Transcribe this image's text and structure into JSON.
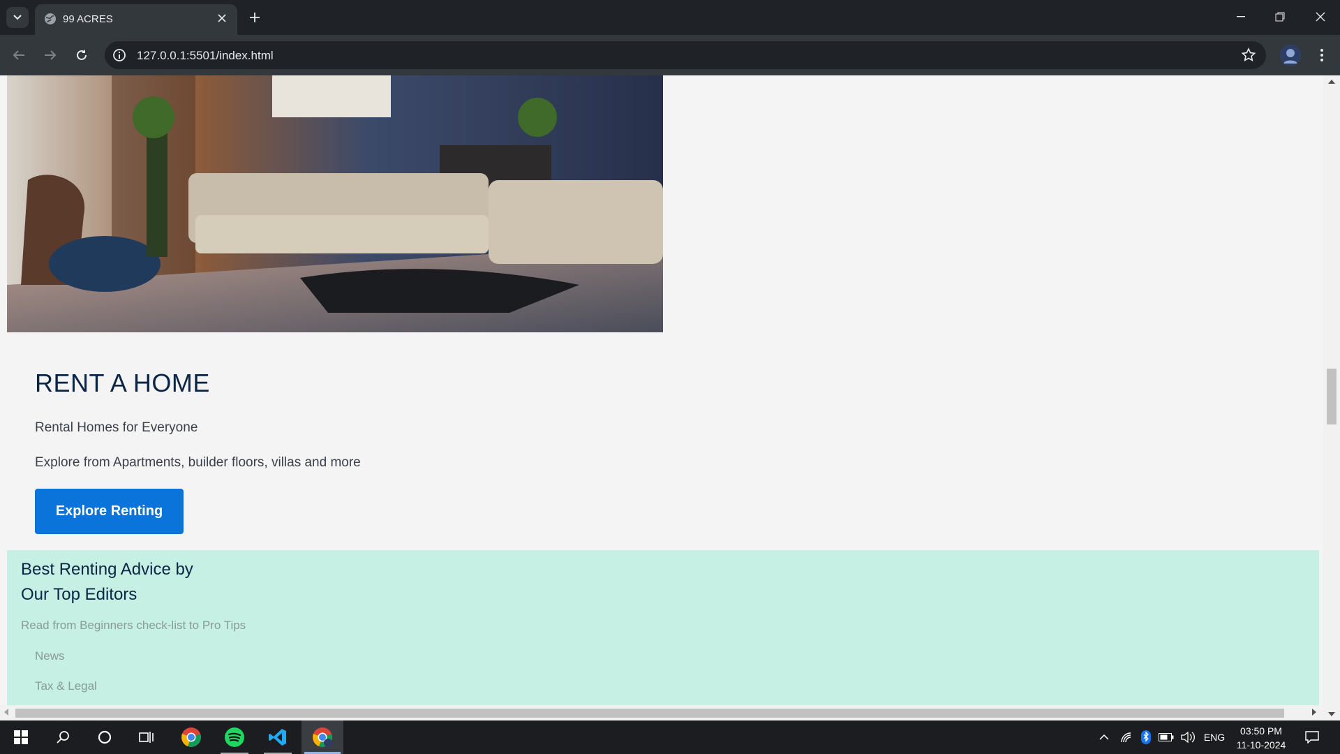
{
  "browser": {
    "tab_title": "99 ACRES",
    "url": "127.0.0.1:5501/index.html"
  },
  "rent": {
    "title": "RENT A HOME",
    "subtitle": "Rental Homes for Everyone",
    "description": "Explore from Apartments, builder floors, villas and more",
    "button_label": "Explore Renting"
  },
  "advice": {
    "title_line1": "Best Renting Advice by",
    "title_line2": "Our Top Editors",
    "subtitle": "Read from Beginners check-list to Pro Tips",
    "links": [
      "News",
      "Tax & Legal"
    ]
  },
  "taskbar": {
    "tray_language": "ENG",
    "time": "03:50 PM",
    "date": "11-10-2024"
  },
  "colors": {
    "accent_blue": "#0a74da",
    "advice_bg": "#c5f0e3",
    "heading": "#0b2545"
  }
}
